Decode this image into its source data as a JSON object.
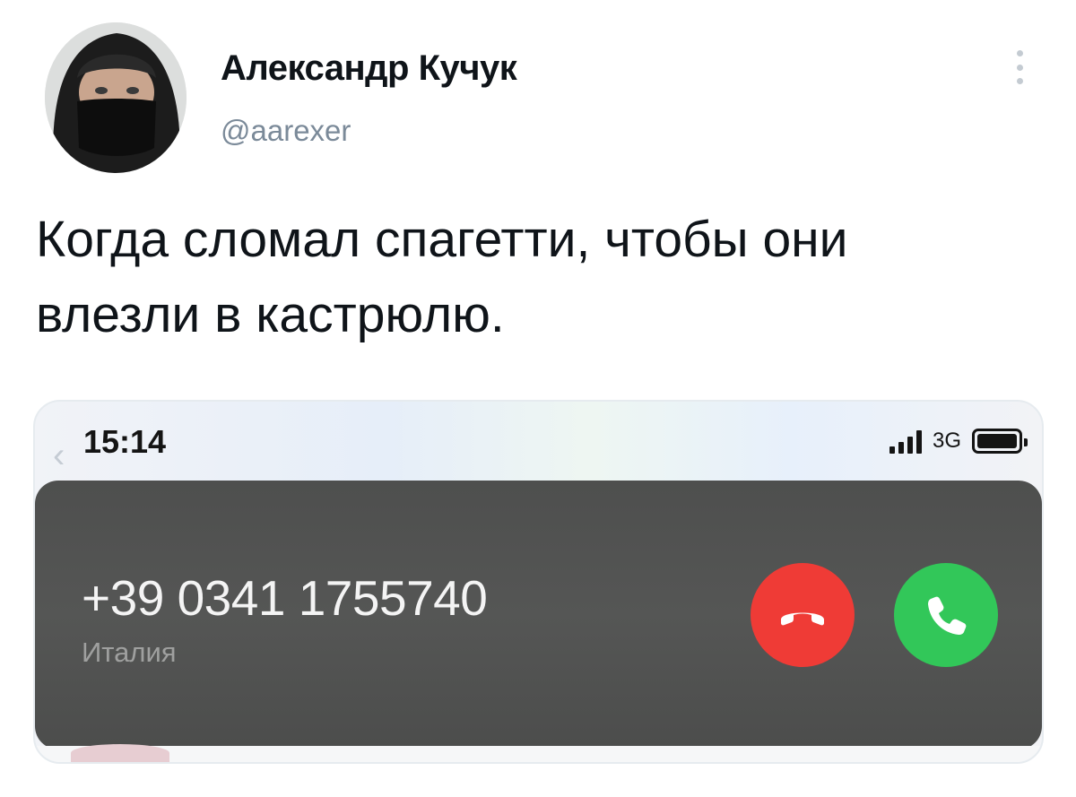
{
  "tweet": {
    "author_name": "Александр Кучук",
    "author_handle": "@aarexer",
    "text_line1": "Когда сломал спагетти, чтобы они",
    "text_line2": "влезли в кастрюлю.",
    "more_icon": "more-vertical-icon"
  },
  "media": {
    "status_time": "15:14",
    "network": "3G",
    "incoming_call": {
      "number": "+39 0341 1755740",
      "location": "Италия",
      "decline_icon": "phone-hangup-icon",
      "accept_icon": "phone-icon"
    },
    "colors": {
      "decline": "#ef3b36",
      "accept": "#32c759",
      "banner": "#555655"
    }
  }
}
